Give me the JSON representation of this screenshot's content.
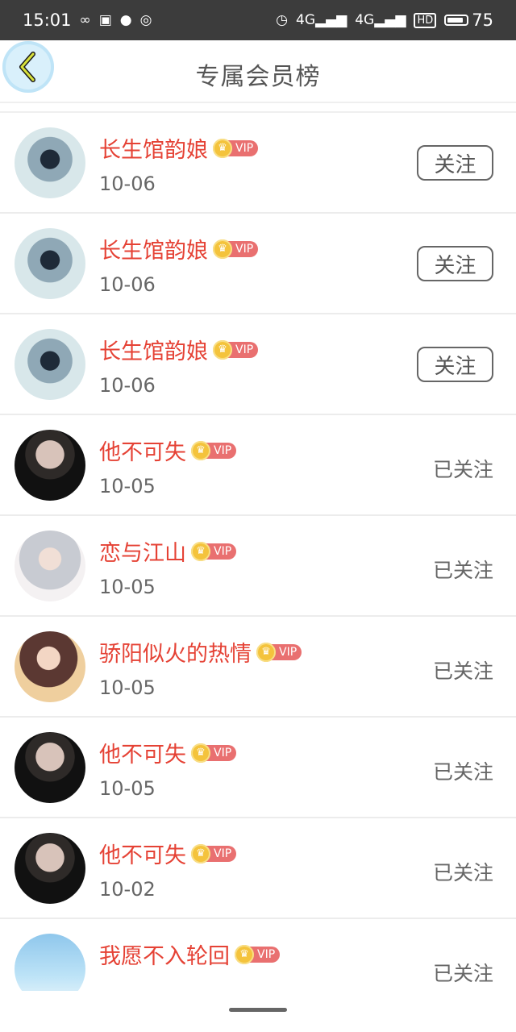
{
  "status_bar": {
    "time": "15:01",
    "icons": [
      "infinity-icon",
      "notification-icon",
      "chat-icon",
      "hotspot-icon",
      "alarm-icon",
      "signal-4g-icon",
      "signal-4g-icon",
      "hd-icon",
      "battery-icon"
    ],
    "network_1": "4G",
    "network_2": "4G",
    "hd_label": "HD",
    "battery_percent": "75"
  },
  "header": {
    "title": "专属会员榜",
    "back_icon": "chevron-left-icon"
  },
  "members": [
    {
      "name": "长生馆韵娘",
      "vip_label": "VIP",
      "date": "10-06",
      "action": "关注",
      "action_type": "button",
      "avatar_style": "av-a"
    },
    {
      "name": "长生馆韵娘",
      "vip_label": "VIP",
      "date": "10-06",
      "action": "关注",
      "action_type": "button",
      "avatar_style": "av-a"
    },
    {
      "name": "长生馆韵娘",
      "vip_label": "VIP",
      "date": "10-06",
      "action": "关注",
      "action_type": "button",
      "avatar_style": "av-a"
    },
    {
      "name": "他不可失",
      "vip_label": "VIP",
      "date": "10-05",
      "action": "已关注",
      "action_type": "text",
      "avatar_style": "av-b"
    },
    {
      "name": "恋与江山",
      "vip_label": "VIP",
      "date": "10-05",
      "action": "已关注",
      "action_type": "text",
      "avatar_style": "av-c"
    },
    {
      "name": "骄阳似火的热情",
      "vip_label": "VIP",
      "date": "10-05",
      "action": "已关注",
      "action_type": "text",
      "avatar_style": "av-d"
    },
    {
      "name": "他不可失",
      "vip_label": "VIP",
      "date": "10-05",
      "action": "已关注",
      "action_type": "text",
      "avatar_style": "av-b"
    },
    {
      "name": "他不可失",
      "vip_label": "VIP",
      "date": "10-02",
      "action": "已关注",
      "action_type": "text",
      "avatar_style": "av-b"
    },
    {
      "name": "我愿不入轮回",
      "vip_label": "VIP",
      "date": "",
      "action": "已关注",
      "action_type": "text",
      "avatar_style": "av-e"
    }
  ],
  "colors": {
    "status_bar_bg": "#3c3c3c",
    "name": "#e54235",
    "vip_bg": "#e97070",
    "crown": "#f4c33c",
    "back_button_bg": "#d9f0fb"
  }
}
